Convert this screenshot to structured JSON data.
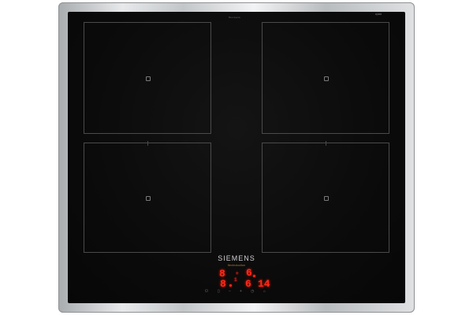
{
  "brand": {
    "name": "SIEMENS",
    "sub": "flexInduction"
  },
  "top_text": "Siemens",
  "series_badge": "iQ300",
  "cooking_zones": [
    {
      "name": "zone-top-left"
    },
    {
      "name": "zone-top-right"
    },
    {
      "name": "zone-bottom-left"
    },
    {
      "name": "zone-bottom-right"
    }
  ],
  "display": {
    "row1_left": "8",
    "row1_right": "6",
    "row2_left": "8",
    "row2_mid": "6",
    "row2_right": "14",
    "plus": "+",
    "indicator": "1"
  },
  "colors": {
    "frame": "#c3c6c9",
    "glass": "#0b0b0b",
    "zone_outline": "#4a4a4a",
    "led": "#ff2a1a"
  }
}
